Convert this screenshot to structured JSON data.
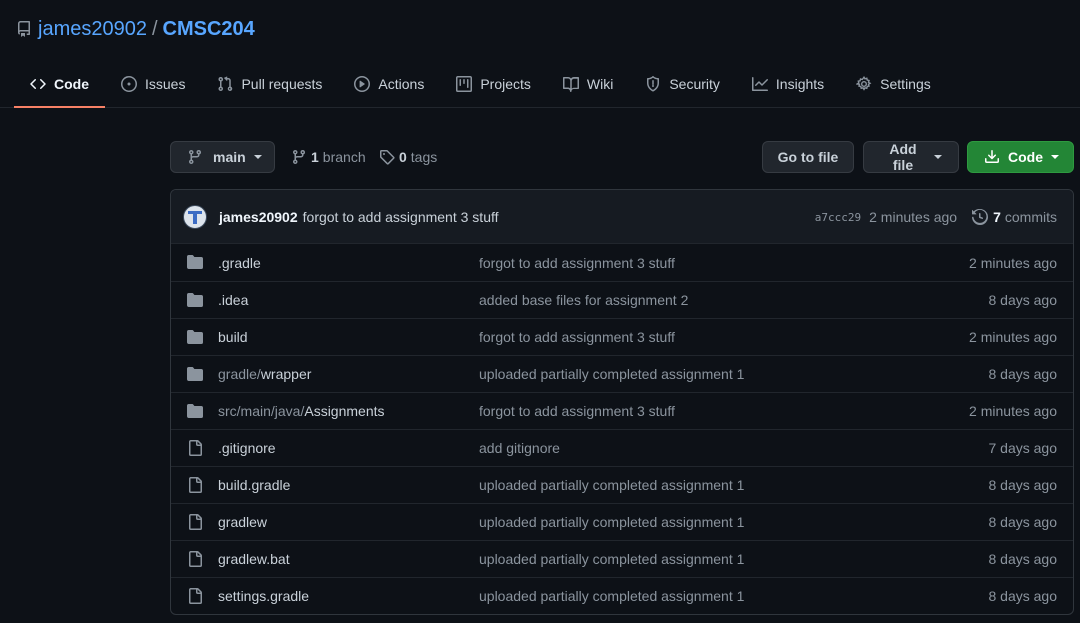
{
  "repo": {
    "owner": "james20902",
    "separator": "/",
    "name": "CMSC204"
  },
  "tabs": [
    {
      "label": "Code",
      "icon": "code-icon"
    },
    {
      "label": "Issues",
      "icon": "issue-icon"
    },
    {
      "label": "Pull requests",
      "icon": "pull-request-icon"
    },
    {
      "label": "Actions",
      "icon": "play-icon"
    },
    {
      "label": "Projects",
      "icon": "project-icon"
    },
    {
      "label": "Wiki",
      "icon": "book-icon"
    },
    {
      "label": "Security",
      "icon": "shield-icon"
    },
    {
      "label": "Insights",
      "icon": "graph-icon"
    },
    {
      "label": "Settings",
      "icon": "gear-icon"
    }
  ],
  "toolbar": {
    "branch": "main",
    "branch_count": "1",
    "branch_label": "branch",
    "tag_count": "0",
    "tag_label": "tags",
    "goto_label": "Go to file",
    "addfile_label": "Add file",
    "code_label": "Code"
  },
  "commit": {
    "author": "james20902",
    "message": "forgot to add assignment 3 stuff",
    "sha": "a7ccc29",
    "time": "2 minutes ago",
    "count": "7",
    "count_label": "commits"
  },
  "files": [
    {
      "type": "dir",
      "prefix": "",
      "name": ".gradle",
      "message": "forgot to add assignment 3 stuff",
      "age": "2 minutes ago"
    },
    {
      "type": "dir",
      "prefix": "",
      "name": ".idea",
      "message": "added base files for assignment 2",
      "age": "8 days ago"
    },
    {
      "type": "dir",
      "prefix": "",
      "name": "build",
      "message": "forgot to add assignment 3 stuff",
      "age": "2 minutes ago"
    },
    {
      "type": "dir",
      "prefix": "gradle/",
      "name": "wrapper",
      "message": "uploaded partially completed assignment 1",
      "age": "8 days ago"
    },
    {
      "type": "dir",
      "prefix": "src/main/java/",
      "name": "Assignments",
      "message": "forgot to add assignment 3 stuff",
      "age": "2 minutes ago"
    },
    {
      "type": "file",
      "prefix": "",
      "name": ".gitignore",
      "message": "add gitignore",
      "age": "7 days ago"
    },
    {
      "type": "file",
      "prefix": "",
      "name": "build.gradle",
      "message": "uploaded partially completed assignment 1",
      "age": "8 days ago"
    },
    {
      "type": "file",
      "prefix": "",
      "name": "gradlew",
      "message": "uploaded partially completed assignment 1",
      "age": "8 days ago"
    },
    {
      "type": "file",
      "prefix": "",
      "name": "gradlew.bat",
      "message": "uploaded partially completed assignment 1",
      "age": "8 days ago"
    },
    {
      "type": "file",
      "prefix": "",
      "name": "settings.gradle",
      "message": "uploaded partially completed assignment 1",
      "age": "8 days ago"
    }
  ]
}
